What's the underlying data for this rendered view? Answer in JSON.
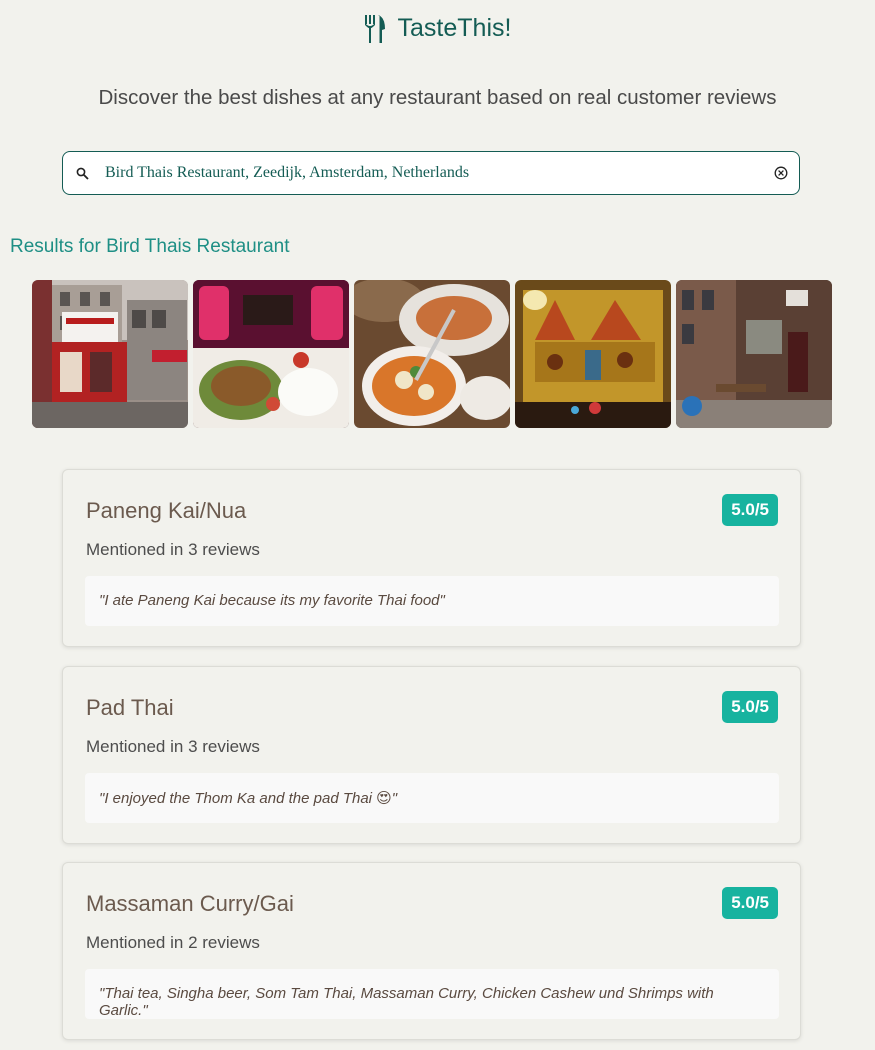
{
  "app": {
    "title": "TasteThis!",
    "subtitle": "Discover the best dishes at any restaurant based on real customer reviews"
  },
  "search": {
    "value": "Bird Thais Restaurant, Zeedijk, Amsterdam, Netherlands"
  },
  "results": {
    "heading": "Results for Bird Thais Restaurant"
  },
  "photos": [
    "storefront-photo",
    "dish-photo",
    "soup-photo",
    "mural-photo",
    "street-photo"
  ],
  "dishes": [
    {
      "name": "Paneng Kai/Nua",
      "rating": "5.0/5",
      "mentions": "Mentioned in 3 reviews",
      "quote": "\"I ate Paneng Kai because its my favorite Thai food\""
    },
    {
      "name": "Pad Thai",
      "rating": "5.0/5",
      "mentions": "Mentioned in 3 reviews",
      "quote": "\"I enjoyed the Thom Ka and the pad Thai 😍\""
    },
    {
      "name": "Massaman Curry/Gai",
      "rating": "5.0/5",
      "mentions": "Mentioned in 2 reviews",
      "quote": "\"Thai tea, Singha beer, Som Tam Thai, Massaman Curry, Chicken Cashew und Shrimps with Garlic.\""
    }
  ],
  "colors": {
    "brand": "#145c54",
    "accent": "#1e8f85",
    "badge": "#17b39f",
    "background": "#f2f2ed"
  }
}
